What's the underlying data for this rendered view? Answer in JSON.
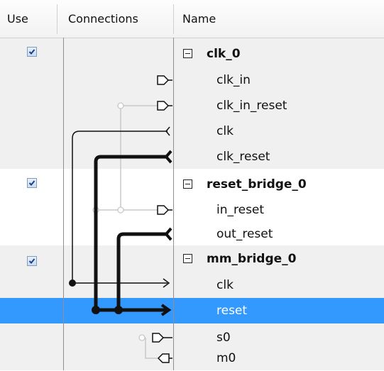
{
  "columns": {
    "use": "Use",
    "connections": "Connections",
    "name": "Name"
  },
  "rows": [
    {
      "kind": "group",
      "label": "clk_0",
      "use": true
    },
    {
      "kind": "port",
      "label": "clk_in"
    },
    {
      "kind": "port",
      "label": "clk_in_reset"
    },
    {
      "kind": "port",
      "label": "clk"
    },
    {
      "kind": "port",
      "label": "clk_reset"
    },
    {
      "kind": "group",
      "label": "reset_bridge_0",
      "use": true
    },
    {
      "kind": "port",
      "label": "in_reset"
    },
    {
      "kind": "port",
      "label": "out_reset"
    },
    {
      "kind": "group",
      "label": "mm_bridge_0",
      "use": true
    },
    {
      "kind": "port",
      "label": "clk"
    },
    {
      "kind": "port",
      "label": "reset",
      "selected": true
    },
    {
      "kind": "port",
      "label": "s0"
    },
    {
      "kind": "port",
      "label": "m0"
    }
  ],
  "colors": {
    "selection": "#3399ff",
    "row_alt": "#f0f0f0",
    "checkbox_border": "#7f9db9",
    "check": "#1d3f8c"
  }
}
